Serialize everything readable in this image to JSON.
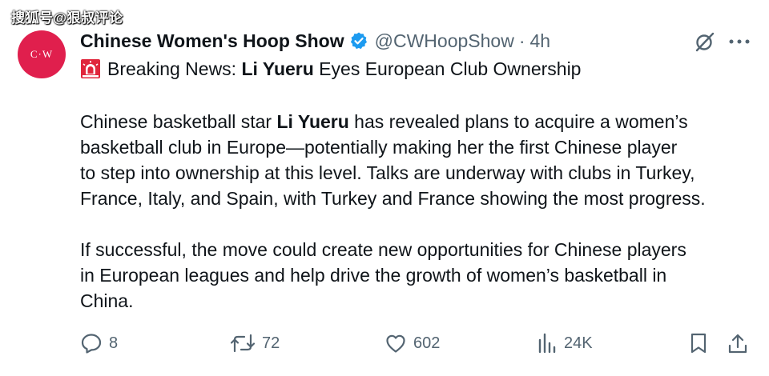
{
  "watermark": "搜狐号@狠叔评论",
  "tweet": {
    "avatar_text": "C·W",
    "display_name": "Chinese Women's Hoop Show",
    "handle": "@CWHoopShow",
    "separator": "·",
    "time": "4h",
    "headline": {
      "prefix": "Breaking News: ",
      "bold": "Li Yueru",
      "suffix": " Eyes European Club Ownership"
    },
    "paragraph1": {
      "line1_prefix": "Chinese basketball star ",
      "line1_bold": "Li Yueru",
      "line1_suffix": " has revealed plans to acquire a women’s",
      "line2": "basketball club in Europe—potentially making her the first Chinese player",
      "line3": "to step into ownership at this level. Talks are underway with clubs in Turkey,",
      "line4": "France, Italy, and Spain, with Turkey and France showing the most progress."
    },
    "paragraph2": {
      "line1": "If successful, the move could create new opportunities for Chinese players",
      "line2": "in European leagues and help drive the growth of women’s basketball in",
      "line3": "China."
    },
    "actions": {
      "replies": "8",
      "reposts": "72",
      "likes": "602",
      "views": "24K"
    }
  },
  "icons": {
    "verified": "verified-badge-icon",
    "grok": "grok-icon",
    "more": "more-icon",
    "siren": "rotating-light-emoji-icon",
    "reply": "reply-icon",
    "repost": "repost-icon",
    "like": "heart-icon",
    "views": "views-icon",
    "bookmark": "bookmark-icon",
    "share": "share-icon"
  },
  "colors": {
    "text": "#0f1419",
    "secondary": "#536471",
    "verified": "#1d9bf0",
    "avatar": "#e01f4d"
  }
}
